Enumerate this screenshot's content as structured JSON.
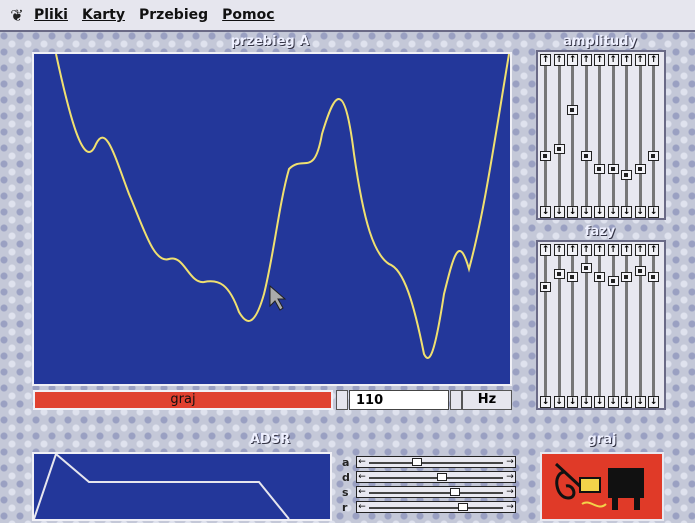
{
  "menu": {
    "items": [
      "Pliki",
      "Karty",
      "Przebieg",
      "Pomoc"
    ]
  },
  "waveform": {
    "title": "przebieg A",
    "color": "#f0e070",
    "background": "#23379a"
  },
  "play": {
    "label": "graj"
  },
  "frequency": {
    "value": "110",
    "unit": "Hz"
  },
  "amplitudes": {
    "title": "amplitudy",
    "levels": [
      0.35,
      0.4,
      0.7,
      0.35,
      0.25,
      0.25,
      0.2,
      0.25,
      0.35
    ]
  },
  "phases": {
    "title": "fazy",
    "levels": [
      0.8,
      0.9,
      0.88,
      0.95,
      0.88,
      0.85,
      0.88,
      0.92,
      0.88
    ]
  },
  "adsr": {
    "title": "ADSR",
    "labels": [
      "a",
      "d",
      "s",
      "r"
    ],
    "levels": [
      0.35,
      0.55,
      0.65,
      0.72
    ]
  },
  "instrument": {
    "title": "graj",
    "icon": "instruments-icon"
  },
  "colors": {
    "accent": "#e0412f",
    "panel_blue": "#23379a",
    "trace": "#f0e070"
  }
}
